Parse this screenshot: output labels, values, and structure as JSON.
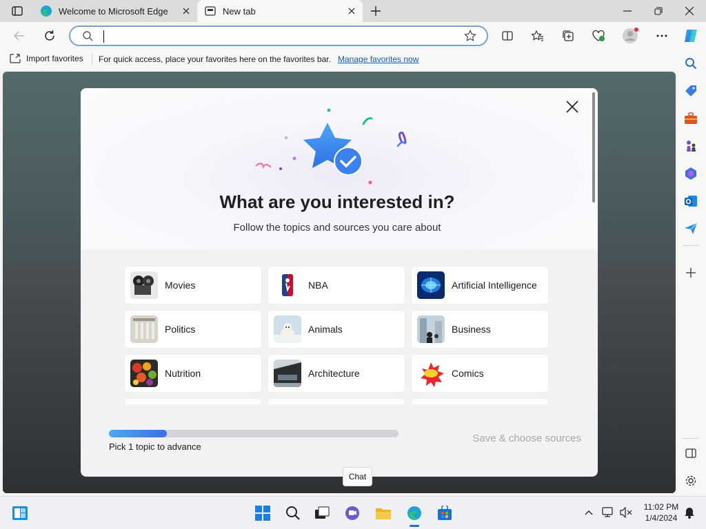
{
  "browser": {
    "tabs": [
      {
        "label": "Welcome to Microsoft Edge",
        "icon": "edge-icon",
        "active": false
      },
      {
        "label": "New tab",
        "icon": "newtab-icon",
        "active": true
      }
    ],
    "address_value": "",
    "favorites_bar": {
      "import_label": "Import favorites",
      "hint": "For quick access, place your favorites here on the favorites bar.",
      "manage_link": "Manage favorites now"
    }
  },
  "dialog": {
    "title": "What are you interested in?",
    "subtitle": "Follow the topics and sources you care about",
    "topics": [
      {
        "label": "Movies",
        "thumb": "movies"
      },
      {
        "label": "NBA",
        "thumb": "nba"
      },
      {
        "label": "Artificial Intelligence",
        "thumb": "ai"
      },
      {
        "label": "Politics",
        "thumb": "politics"
      },
      {
        "label": "Animals",
        "thumb": "animals"
      },
      {
        "label": "Business",
        "thumb": "business"
      },
      {
        "label": "Nutrition",
        "thumb": "nutrition"
      },
      {
        "label": "Architecture",
        "thumb": "architecture"
      },
      {
        "label": "Comics",
        "thumb": "comics"
      }
    ],
    "progress_fraction": 0.2,
    "progress_label": "Pick 1 topic to advance",
    "save_label": "Save & choose sources"
  },
  "tooltip": {
    "label": "Chat"
  },
  "taskbar": {
    "time": "11:02 PM",
    "date": "1/4/2024"
  },
  "colors": {
    "accent": "#0c5cc2",
    "progress_start": "#4aa8f0",
    "progress_end": "#3f6ee8"
  }
}
